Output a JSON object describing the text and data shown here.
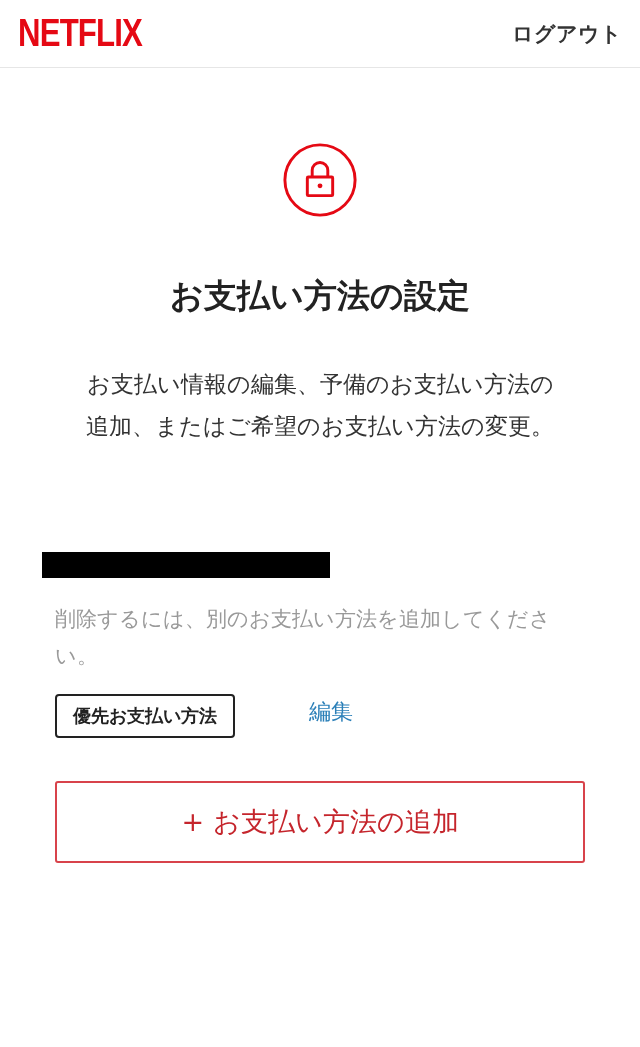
{
  "header": {
    "logo": "NETFLIX",
    "logout": "ログアウト"
  },
  "title": "お支払い方法の設定",
  "description": "お支払い情報の編集、予備のお支払い方法の追加、またはご希望のお支払い方法の変更。",
  "payment": {
    "note": "削除するには、別のお支払い方法を追加してください。",
    "badge": "優先お支払い方法",
    "edit": "編集"
  },
  "add_button": "+ お支払い方法の追加"
}
